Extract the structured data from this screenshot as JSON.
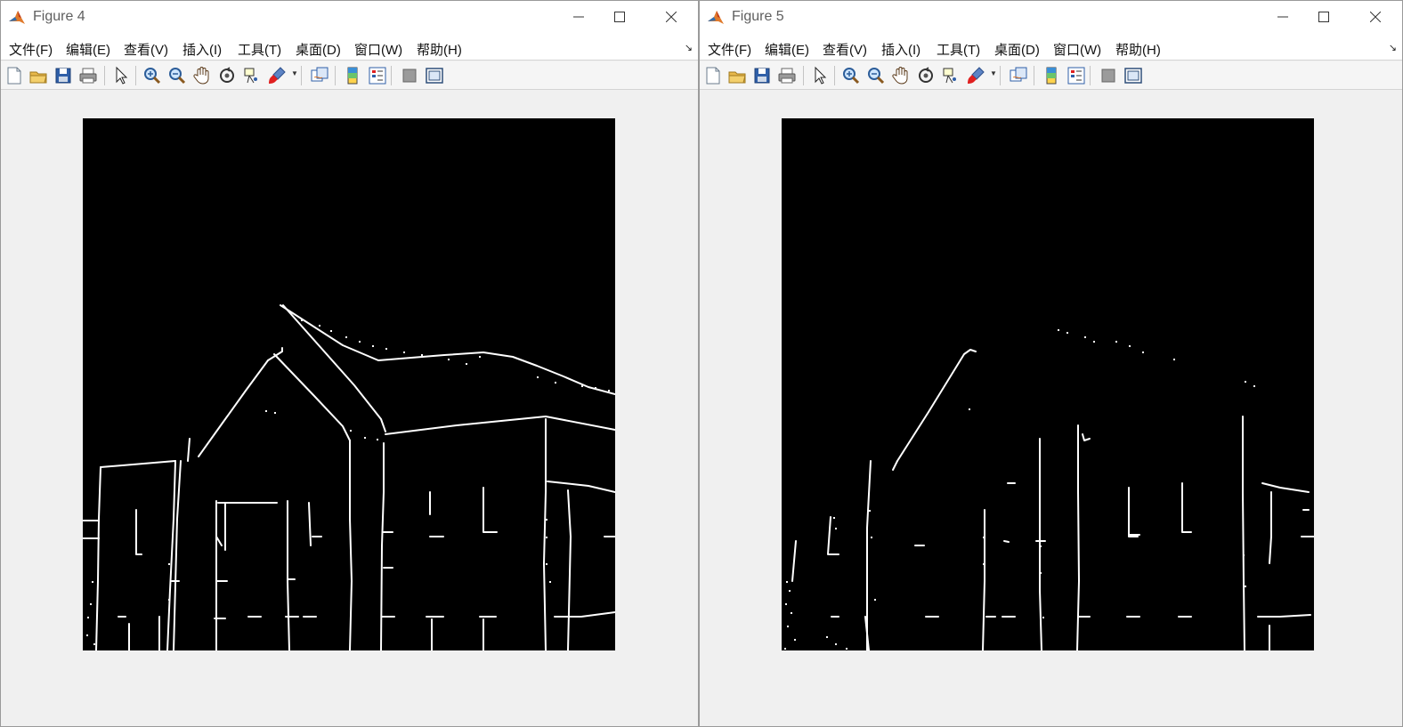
{
  "figure4": {
    "title": "Figure 4",
    "menu": [
      "文件(F)",
      "编辑(E)",
      "查看(V)",
      "插入(I)",
      "工具(T)",
      "桌面(D)",
      "窗口(W)",
      "帮助(H)"
    ]
  },
  "figure5": {
    "title": "Figure 5",
    "menu": [
      "文件(F)",
      "编辑(E)",
      "查看(V)",
      "插入(I)",
      "工具(T)",
      "桌面(D)",
      "窗口(W)",
      "帮助(H)"
    ]
  },
  "toolbar_icons": [
    "new-figure-icon",
    "open-file-icon",
    "save-icon",
    "print-icon",
    "edit-plot-arrow-icon",
    "zoom-in-icon",
    "zoom-out-icon",
    "pan-hand-icon",
    "rotate-3d-icon",
    "data-cursor-icon",
    "brush-icon",
    "link-plot-icon",
    "colorbar-icon",
    "legend-icon",
    "hide-tools-icon",
    "show-tools-icon"
  ],
  "colors": {
    "axes_background": "#000000",
    "edge_pixels": "#ffffff",
    "window_bg": "#f0f0f0",
    "brush_accent": "#e02020"
  }
}
